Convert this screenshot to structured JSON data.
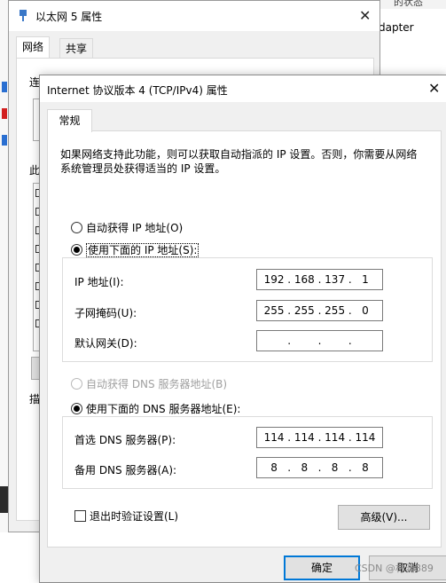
{
  "background": {
    "topright_text": "的状态",
    "right_text": "dapter",
    "dialog_title": "以太网 5 属性",
    "tabs": [
      "网络",
      "共享"
    ],
    "partial_label_1": "连",
    "partial_label_2": "此",
    "partial_label_3": "描"
  },
  "dialog": {
    "title": "Internet 协议版本 4 (TCP/IPv4) 属性",
    "close": "✕",
    "tab_general": "常规",
    "description": "如果网络支持此功能，则可以获取自动指派的 IP 设置。否则，你需要从网络系统管理员处获得适当的 IP 设置。",
    "ip_auto_label": "自动获得 IP 地址(O)",
    "ip_manual_label": "使用下面的 IP 地址(S):",
    "ip_label": "IP 地址(I):",
    "mask_label": "子网掩码(U):",
    "gateway_label": "默认网关(D):",
    "ip_octets": [
      "192",
      "168",
      "137",
      "1"
    ],
    "mask_octets": [
      "255",
      "255",
      "255",
      "0"
    ],
    "gateway_octets": [
      "",
      "",
      "",
      ""
    ],
    "dns_auto_label": "自动获得 DNS 服务器地址(B)",
    "dns_manual_label": "使用下面的 DNS 服务器地址(E):",
    "dns_pref_label": "首选 DNS 服务器(P):",
    "dns_alt_label": "备用 DNS 服务器(A):",
    "dns_pref_octets": [
      "114",
      "114",
      "114",
      "114"
    ],
    "dns_alt_octets": [
      "8",
      "8",
      "8",
      "8"
    ],
    "validate_label": "退出时验证设置(L)",
    "advanced_button": "高级(V)...",
    "ok_button": "确定",
    "cancel_button": "取消"
  },
  "watermark": "CSDN @林渊889"
}
